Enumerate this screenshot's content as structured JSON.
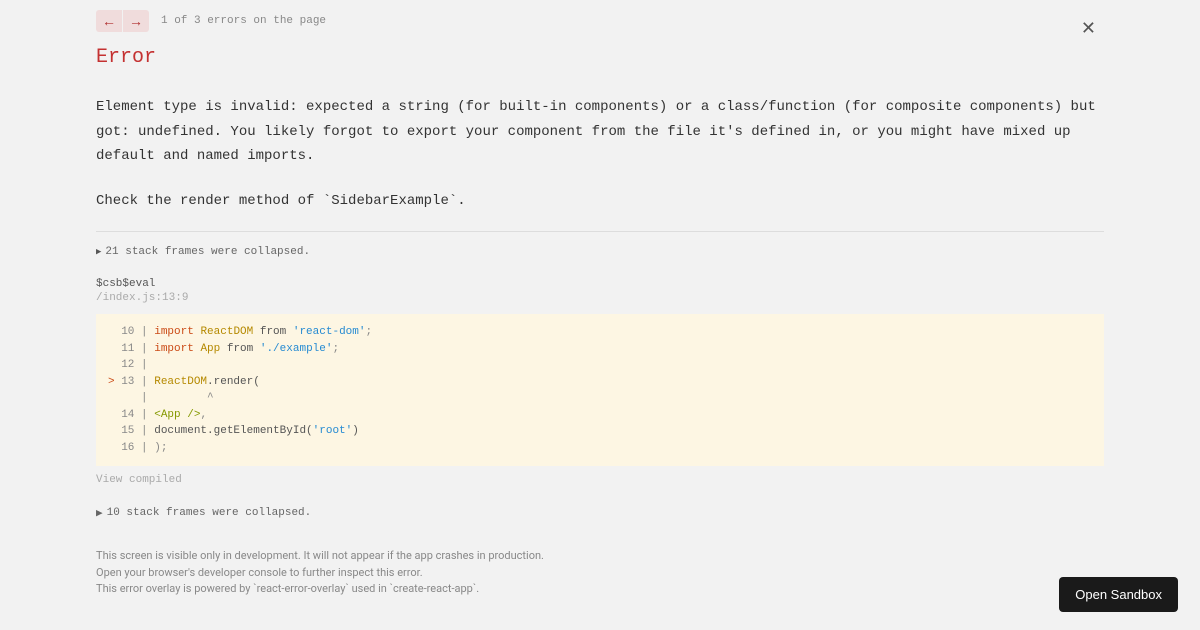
{
  "nav": {
    "counter": "1 of 3 errors on the page"
  },
  "error": {
    "title": "Error",
    "message": "Element type is invalid: expected a string (for built-in components) or a class/function (for composite components) but got: undefined. You likely forgot to export your component from the file it's defined in, or you might have mixed up default and named imports.",
    "check": "Check the render method of `SidebarExample`."
  },
  "frames": {
    "collapsed1": "21 stack frames were collapsed.",
    "header": "$csb$eval",
    "location": "/index.js:13:9",
    "collapsed2": "10 stack frames were collapsed.",
    "viewCompiled": "View compiled"
  },
  "code": {
    "l10_num": "  10 | ",
    "l10_kw": "import",
    "l10_sp1": " ",
    "l10_type": "ReactDOM",
    "l10_rest": " from ",
    "l10_str": "'react-dom'",
    "l10_end": ";",
    "l11_num": "  11 | ",
    "l11_kw": "import",
    "l11_sp1": " ",
    "l11_type": "App",
    "l11_rest": " from ",
    "l11_str": "'./example'",
    "l11_end": ";",
    "l12_num": "  12 | ",
    "l13_marker": "> ",
    "l13_num": "13 | ",
    "l13_type": "ReactDOM",
    "l13_rest": ".render(",
    "l13b": "     |         ^",
    "l14_num": "  14 | ",
    "l14_tag": "<App />",
    "l14_end": ",",
    "l15_num": "  15 | ",
    "l15_rest": "document.getElementById(",
    "l15_str": "'root'",
    "l15_end": ")",
    "l16_num": "  16 | ",
    "l16_end": ");"
  },
  "footer": {
    "line1": "This screen is visible only in development. It will not appear if the app crashes in production.",
    "line2": "Open your browser's developer console to further inspect this error.",
    "line3": "This error overlay is powered by `react-error-overlay` used in `create-react-app`."
  },
  "sandbox": {
    "label": "Open Sandbox"
  }
}
